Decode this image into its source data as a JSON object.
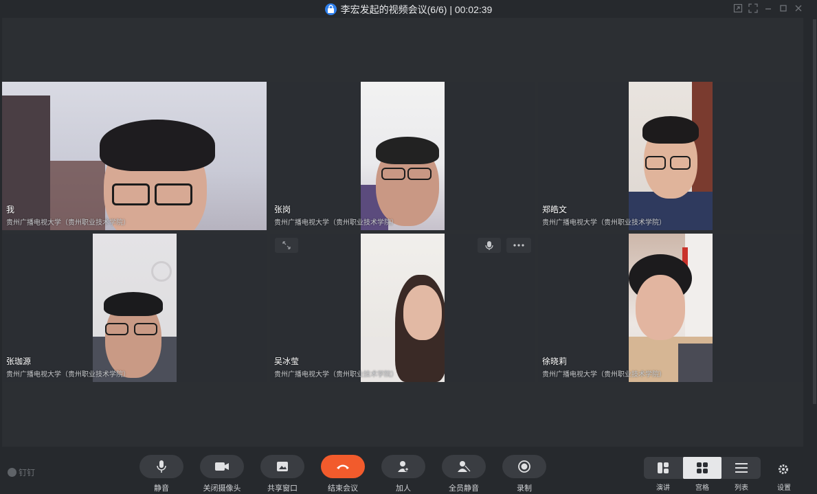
{
  "window": {
    "title": "李宏发起的视频会议(6/6) | 00:02:39"
  },
  "participants": [
    {
      "name": "我",
      "org": "贵州广播电视大学（贵州职业技术学院）"
    },
    {
      "name": "张岗",
      "org": "贵州广播电视大学（贵州职业技术学院）"
    },
    {
      "name": "郑皓文",
      "org": "贵州广播电视大学（贵州职业技术学院）"
    },
    {
      "name": "张珈源",
      "org": "贵州广播电视大学（贵州职业技术学院）"
    },
    {
      "name": "吴冰莹",
      "org": "贵州广播电视大学（贵州职业技术学院）"
    },
    {
      "name": "徐晓莉",
      "org": "贵州广播电视大学（贵州职业技术学院）"
    }
  ],
  "brand": "钉钉",
  "controls": [
    {
      "label": "静音",
      "icon": "microphone-icon"
    },
    {
      "label": "关闭摄像头",
      "icon": "camera-icon"
    },
    {
      "label": "共享窗口",
      "icon": "share-window-icon"
    },
    {
      "label": "结束会议",
      "icon": "hang-up-icon"
    },
    {
      "label": "加人",
      "icon": "add-person-icon"
    },
    {
      "label": "全员静音",
      "icon": "mute-all-icon"
    },
    {
      "label": "录制",
      "icon": "record-icon"
    }
  ],
  "layout": {
    "speaker": "演讲",
    "grid": "宫格",
    "list": "列表",
    "active": "宫格"
  },
  "settings_label": "设置",
  "colors": {
    "accent_blue": "#2f80ed",
    "end_call": "#f25b2c",
    "background": "#26292d"
  }
}
